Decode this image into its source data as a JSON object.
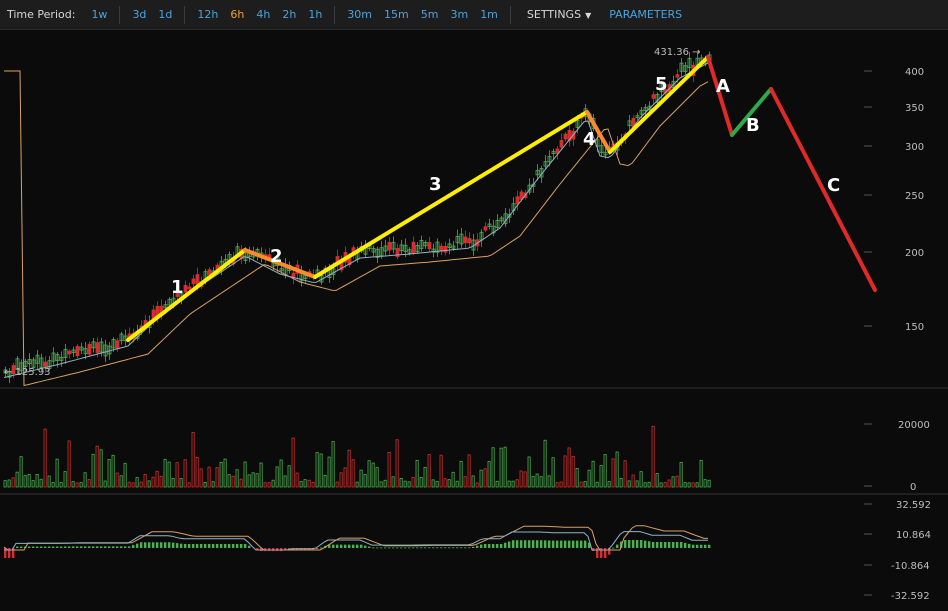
{
  "toolbar": {
    "time_period_label": "Time Period:",
    "periods": [
      "1w",
      "3d",
      "1d",
      "12h",
      "6h",
      "4h",
      "2h",
      "1h",
      "30m",
      "15m",
      "5m",
      "3m",
      "1m"
    ],
    "active_period": "6h",
    "settings_label": "SETTINGS",
    "parameters_label": "PARAMETERS"
  },
  "price_axis": {
    "ticks": [
      "400",
      "350",
      "300",
      "250",
      "200",
      "150"
    ],
    "high_marker": "431.36 →",
    "low_marker": "← 125.93"
  },
  "volume_axis": {
    "ticks": [
      "20000",
      "0"
    ]
  },
  "macd_axis": {
    "ticks": [
      "32.592",
      "10.864",
      "-10.864",
      "-32.592"
    ]
  },
  "wave_labels": [
    "1",
    "2",
    "3",
    "4",
    "5",
    "A",
    "B",
    "C"
  ],
  "colors": {
    "impulse": "#ffee00",
    "correction": "#ff8a2a",
    "abc_down": "#e02a2a",
    "abc_up": "#2fa84a",
    "candle_up": "#4caf50",
    "candle_down": "#d32f2f",
    "ma_fast": "#8fb3c9",
    "ma_slow": "#d9a066"
  }
}
